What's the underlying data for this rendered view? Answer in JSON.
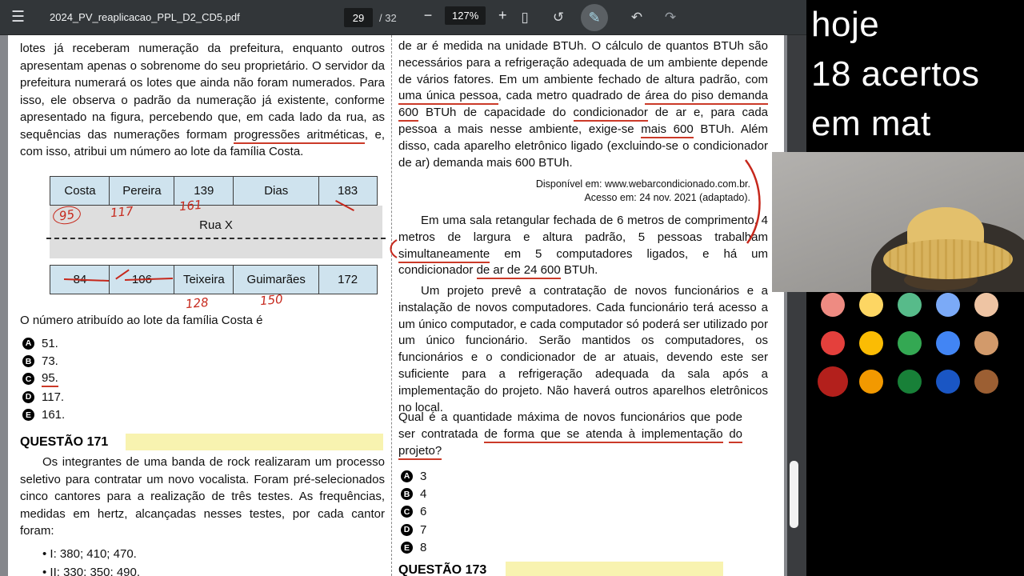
{
  "toolbar": {
    "filename": "2024_PV_reaplicacao_PPL_D2_CD5.pdf",
    "page_current": "29",
    "page_total": "/ 32",
    "zoom_level": "127%",
    "icons": {
      "menu": "☰",
      "zoom_out": "−",
      "zoom_in": "+",
      "fit": "▯",
      "rotate": "↺",
      "pen": "✎",
      "undo": "↶",
      "redo": "↷"
    }
  },
  "pdf": {
    "left_column": {
      "p1_segments": [
        {
          "t": "lotes já receberam numeração da prefeitura, enquanto outros apresentam apenas o sobrenome do seu proprietário. O servidor da prefeitura numerará os lotes que ainda não foram numerados. Para isso, ele observa o padrão da numeração já existente, conforme apresentado na figura, percebendo que, em cada lado da rua, as sequências das numerações formam ",
          "m": false
        },
        {
          "t": "progressões aritméticas",
          "m": true
        },
        {
          "t": ", e, com isso, atribui um número ao lote da família Costa.",
          "m": false
        }
      ],
      "figure": {
        "top_row": [
          "Costa",
          "Pereira",
          "139",
          "Dias",
          "183"
        ],
        "street_label": "Rua X",
        "bottom_row": [
          "84",
          "106",
          "Teixeira",
          "Guimarães",
          "172"
        ]
      },
      "stem": "O número atribuído ao lote da família Costa é",
      "options": [
        {
          "letter": "A",
          "text": "51."
        },
        {
          "letter": "B",
          "text": "73."
        },
        {
          "letter": "C",
          "text": "95.",
          "marked": true
        },
        {
          "letter": "D",
          "text": "117."
        },
        {
          "letter": "E",
          "text": "161."
        }
      ],
      "q171_heading": "QUESTÃO 171",
      "q171_text": "Os integrantes de uma banda de rock realizaram um processo seletivo para contratar um novo vocalista. Foram pré-selecionados cinco cantores para a realização de três testes. As frequências, medidas em hertz, alcançadas nesses testes, por cada cantor foram:",
      "q171_items": [
        "• I: 380; 410; 470.",
        "• II: 330; 350; 490."
      ]
    },
    "right_column": {
      "p1_segments": [
        {
          "t": "de ar é medida na unidade BTUh. O cálculo de quantos BTUh são necessários para a refrigeração adequada de um ambiente depende de vários fatores. Em um ambiente fechado de altura padrão, com ",
          "m": false
        },
        {
          "t": "uma única pessoa",
          "m": true
        },
        {
          "t": ", cada metro quadrado de ",
          "m": false
        },
        {
          "t": "área do piso demanda 600",
          "m": true
        },
        {
          "t": " BTUh de capacidade do ",
          "m": false
        },
        {
          "t": "condicionador",
          "m": true
        },
        {
          "t": " de ar e, para cada pessoa a mais nesse ambiente, exige-se ",
          "m": false
        },
        {
          "t": "mais 600",
          "m": true
        },
        {
          "t": " BTUh. Além disso, cada aparelho eletrônico ligado (excluindo-se o condicionador de ar) demanda mais 600 BTUh.",
          "m": false
        }
      ],
      "source_line1": "Disponível em: www.webarcondicionado.com.br.",
      "source_line2": "Acesso em: 24 nov. 2021 (adaptado).",
      "sala_segments": [
        {
          "t": "Em uma sala retangular fechada de 6 metros de comprimento, 4 metros de largura e altura padrão, 5 pessoas trabalham ",
          "m": false
        },
        {
          "t": "simultaneamente",
          "m": true
        },
        {
          "t": " em 5 computadores ligados, e há um condicionador ",
          "m": false
        },
        {
          "t": "de ar de 24 600",
          "m": true
        },
        {
          "t": " BTUh.",
          "m": false
        }
      ],
      "projeto_text": "Um projeto prevê a contratação de novos funcionários e a instalação de novos computadores. Cada funcionário terá acesso a um único computador, e cada computador só poderá ser utilizado por um único funcionário. Serão mantidos os computadores, os funcionários e o condicionador de ar atuais, devendo este ser suficiente para a refrigeração adequada da sala após a implementação do projeto. Não haverá outros aparelhos eletrônicos no local.",
      "question_segments": [
        {
          "t": "Qual é a quantidade máxima de novos funcionários que pode ser contratada ",
          "m": false
        },
        {
          "t": "de forma que se atenda à implementação",
          "m": true
        },
        {
          "t": " ",
          "m": false
        },
        {
          "t": "do projeto?",
          "m": true
        }
      ],
      "options": [
        {
          "letter": "A",
          "text": "3"
        },
        {
          "letter": "B",
          "text": "4"
        },
        {
          "letter": "C",
          "text": "6"
        },
        {
          "letter": "D",
          "text": "7"
        },
        {
          "letter": "E",
          "text": "8"
        }
      ],
      "q173_heading": "QUESTÃO 173"
    },
    "annotations": {
      "handwritten": [
        "95",
        "117",
        "161",
        "128",
        "150"
      ]
    }
  },
  "overlay": {
    "lines": [
      "hoje",
      "18 acertos",
      "em mat"
    ]
  },
  "palette": {
    "rows": [
      [
        "#ee8b82",
        "#fdd663",
        "#57bb8a",
        "#7baaf7",
        "#eec4a3"
      ],
      [
        "#e4403c",
        "#fbbc04",
        "#34a853",
        "#4285f4",
        "#d29a6b"
      ],
      [
        "#b3201c",
        "#f29900",
        "#188038",
        "#1a56c4",
        "#9c5f33"
      ]
    ],
    "selected": {
      "row": 2,
      "col": 0
    },
    "annotation_red": "#c6281c",
    "highlight_yellow": "#f8f3b0"
  }
}
